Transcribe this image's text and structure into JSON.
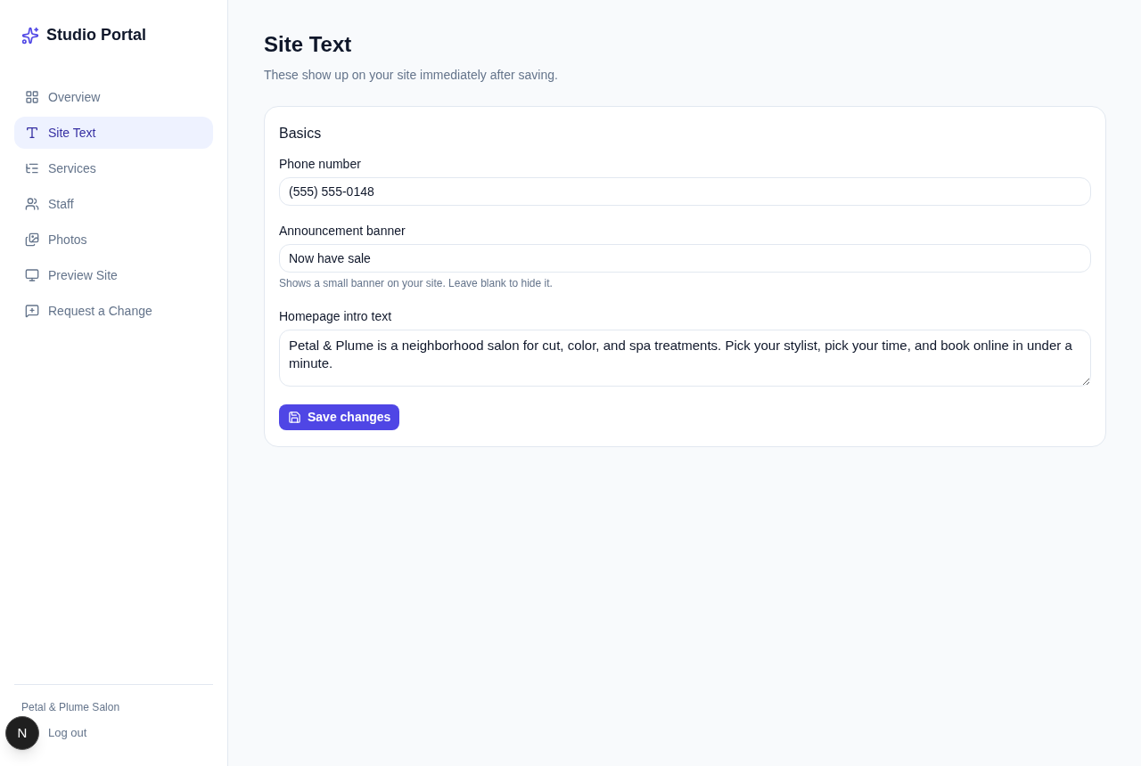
{
  "sidebar": {
    "brand": "Studio Portal",
    "items": [
      {
        "label": "Overview",
        "selected": false
      },
      {
        "label": "Site Text",
        "selected": true
      },
      {
        "label": "Services",
        "selected": false
      },
      {
        "label": "Staff",
        "selected": false
      },
      {
        "label": "Photos",
        "selected": false
      },
      {
        "label": "Preview Site",
        "selected": false
      },
      {
        "label": "Request a Change",
        "selected": false
      }
    ],
    "footer": {
      "business": "Petal & Plume Salon",
      "logout": "Log out"
    }
  },
  "page": {
    "title": "Site Text",
    "subtitle": "These show up on your site immediately after saving."
  },
  "card": {
    "title": "Basics",
    "fields": [
      {
        "kind": "input",
        "label": "Phone number",
        "value": "(555) 555-0148"
      },
      {
        "kind": "input",
        "label": "Announcement banner",
        "value": "Now have sale",
        "hint": "Shows a small banner on your site. Leave blank to hide it."
      },
      {
        "kind": "textarea",
        "label": "Homepage intro text",
        "value": "Petal & Plume is a neighborhood salon for cut, color, and spa treatments. Pick your stylist, pick your time, and book online in under a minute."
      }
    ],
    "button": "Save changes"
  },
  "dev_badge": "N"
}
